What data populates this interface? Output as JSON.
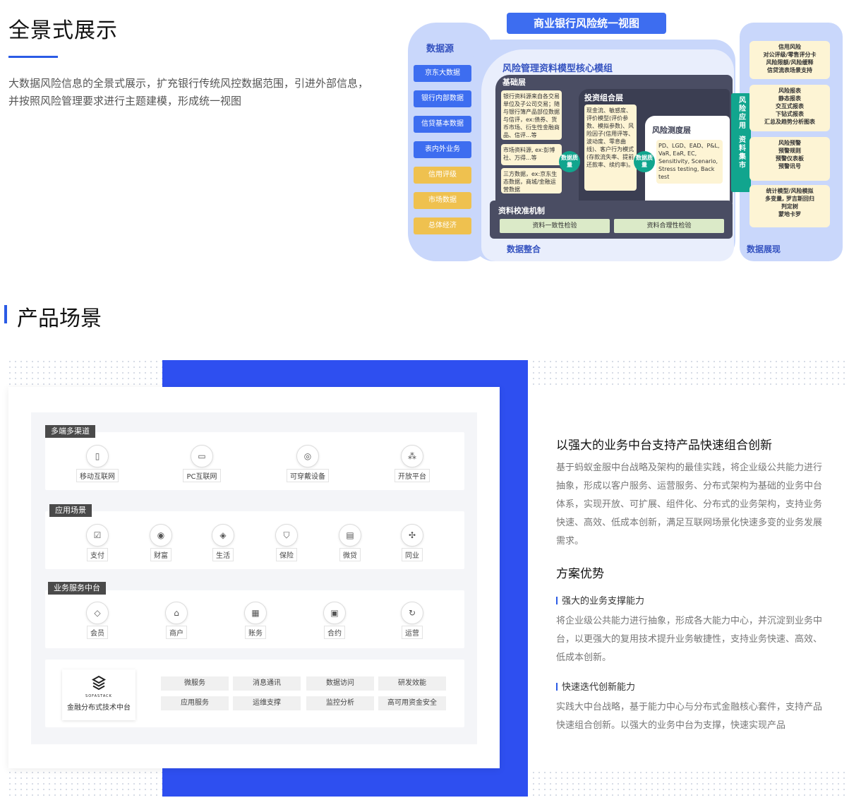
{
  "section1": {
    "title": "全景式展示",
    "description": "大数据风险信息的全景式展示，扩充银行传统风控数据范围，引进外部信息，并按照风险管理要求进行主题建模，形成统一视图"
  },
  "diagram": {
    "title": "商业银行风险统一视图",
    "sources_label": "数据源",
    "sources": [
      "京东大数据",
      "银行内部数据",
      "信贷基本数据",
      "表内外业务",
      "信用评级",
      "市场数据",
      "总体经济"
    ],
    "core_title": "风险管理资料模型核心模组",
    "base_layer": {
      "title": "基础层",
      "box1": "银行资料源来自各交易单位及子公司交易；随与银行簿产品部位数据与信评，ex:债券、货币市场、衍生性金融商品、信评...等",
      "box2": "市场资料源, ex:彭博社、万得...等",
      "box3": "三方数据，ex:京东生态数据，商城/金融运营数据"
    },
    "data_quality": "数据质量",
    "invest_layer": {
      "title": "投资组合层",
      "text": "现金流、敏感度、评价模型(评价参数、模拟参数)、风险因子(信用评等、波动度、零息曲线)、客户行为模式(存款流失率、提前还款率、续约率)。"
    },
    "risk_layer": {
      "title": "风险测度层",
      "text": "PD、LGD、EAD、P&L, VaR, EaR, EC, Sensitivity, Scenario, Stress testing, Back test"
    },
    "calibration": {
      "title": "资料校准机制",
      "check1": "资料一致性检验",
      "check2": "资料合理性检验"
    },
    "integration_label": "数据整合",
    "app_bar": "风险应用",
    "mart_bar": "资料集市",
    "app_cards": [
      "信用风险\n对公评级/零售评分卡\n风险限额/风险缓释\n信贷流表场景支持",
      "风险报表\n静态报表\n交互式报表\n下钻式报表\n汇总及趋势分析图表",
      "风险预警\n预警规则\n预警仪表板\n预警讯号",
      "统计模型/风险模拟\n多变量, 罗吉斯回归\n判定树\n蒙地卡罗"
    ],
    "display_label": "数据展现"
  },
  "section2": {
    "title": "产品场景"
  },
  "architecture": {
    "groups": [
      {
        "tag": "多端多渠道",
        "items": [
          {
            "label": "移动互联网",
            "icon": "mobile-icon"
          },
          {
            "label": "PC互联网",
            "icon": "monitor-icon"
          },
          {
            "label": "可穿戴设备",
            "icon": "watch-icon"
          },
          {
            "label": "开放平台",
            "icon": "share-icon"
          }
        ]
      },
      {
        "tag": "应用场景",
        "items": [
          {
            "label": "支付",
            "icon": "payment-icon"
          },
          {
            "label": "财富",
            "icon": "wealth-icon"
          },
          {
            "label": "生活",
            "icon": "life-icon"
          },
          {
            "label": "保险",
            "icon": "shield-icon"
          },
          {
            "label": "微贷",
            "icon": "loan-icon"
          },
          {
            "label": "同业",
            "icon": "handshake-icon"
          }
        ]
      },
      {
        "tag": "业务服务中台",
        "items": [
          {
            "label": "会员",
            "icon": "diamond-icon"
          },
          {
            "label": "商户",
            "icon": "store-icon"
          },
          {
            "label": "账务",
            "icon": "ledger-icon"
          },
          {
            "label": "合约",
            "icon": "contract-icon"
          },
          {
            "label": "运营",
            "icon": "refresh-icon"
          }
        ]
      }
    ],
    "tech": {
      "logo_text": "SOFASTACK",
      "label": "金融分布式技术中台",
      "chips": [
        "微服务",
        "消息通讯",
        "数据访问",
        "研发效能",
        "应用服务",
        "运维支撑",
        "监控分析",
        "高可用资金安全"
      ]
    }
  },
  "right": {
    "heading": "以强大的业务中台支持产品快速组合创新",
    "intro": "基于蚂蚁金服中台战略及架构的最佳实践，将企业级公共能力进行抽象，形成以客户服务、运营服务、分布式架构为基础的业务中台体系，实现开放、可扩展、组件化、分布式的业务架构，支持业务快速、高效、低成本创新，满足互联网场景化快速多变的业务发展需求。",
    "advantages_title": "方案优势",
    "adv1_title": "强大的业务支撑能力",
    "adv1_text": "将企业级公共能力进行抽象，形成各大能力中心，并沉淀到业务中台，以更强大的复用技术提升业务敏捷性，支持业务快速、高效、低成本创新。",
    "adv2_title": "快速迭代创新能力",
    "adv2_text": "实践大中台战略，基于能力中心与分布式金融核心套件，支持产品快速组合创新。以强大的业务中台为支撑，快速实现产品"
  }
}
